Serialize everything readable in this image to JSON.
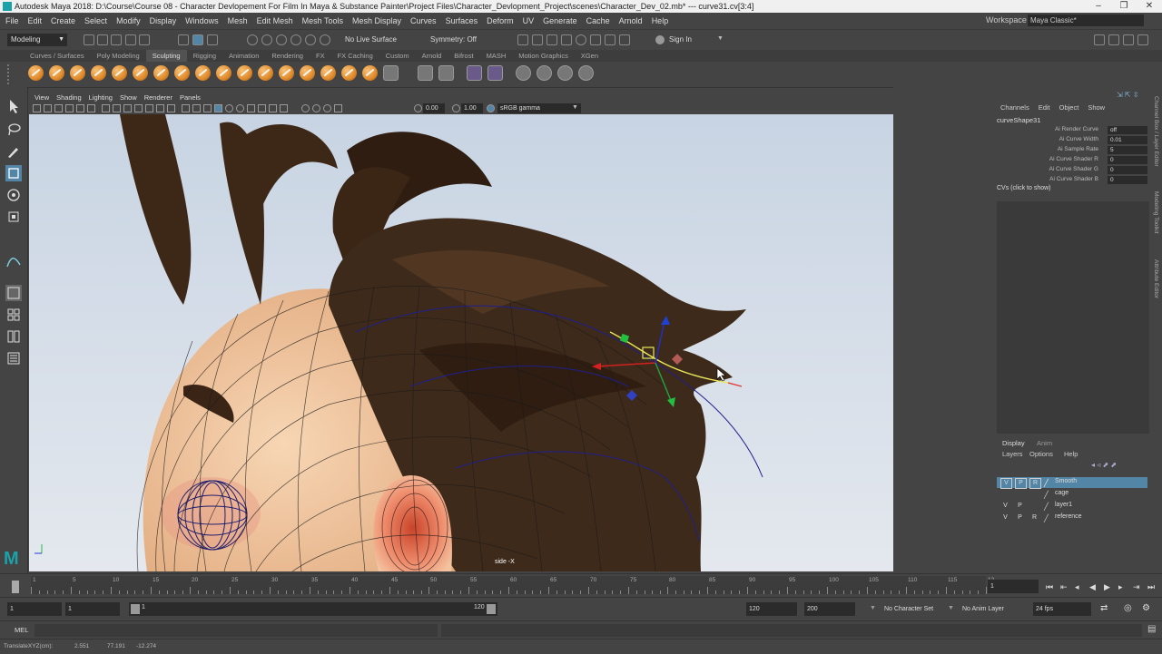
{
  "window": {
    "title": "Autodesk Maya 2018: D:\\Course\\Course 08 - Character Devlopement For Film In Maya & Substance Painter\\Project Files\\Character_Devlopment_Project\\scenes\\Character_Dev_02.mb*   ---   curve31.cv[3:4]",
    "min": "–",
    "max": "❐",
    "close": "✕"
  },
  "menu": {
    "items": [
      "File",
      "Edit",
      "Create",
      "Select",
      "Modify",
      "Display",
      "Windows",
      "Mesh",
      "Edit Mesh",
      "Mesh Tools",
      "Mesh Display",
      "Curves",
      "Surfaces",
      "Deform",
      "UV",
      "Generate",
      "Cache",
      "Arnold",
      "Help"
    ],
    "workspace_label": "Workspace :",
    "workspace_value": "Maya Classic*"
  },
  "statusline": {
    "mode": "Modeling",
    "live_surface": "No Live Surface",
    "symmetry": "Symmetry: Off",
    "sign_in": "Sign In"
  },
  "shelf": {
    "tabs": [
      "Curves / Surfaces",
      "Poly Modeling",
      "Sculpting",
      "Rigging",
      "Animation",
      "Rendering",
      "FX",
      "FX Caching",
      "Custom",
      "Arnold",
      "Bifrost",
      "MASH",
      "Motion Graphics",
      "XGen"
    ],
    "active_tab": "Sculpting"
  },
  "viewport": {
    "menu": [
      "View",
      "Shading",
      "Lighting",
      "Show",
      "Renderer",
      "Panels"
    ],
    "exposure": "0.00",
    "gamma": "1.00",
    "color_space": "sRGB gamma",
    "camera_label": "side -X"
  },
  "channel_box": {
    "menu": [
      "Channels",
      "Edit",
      "Object",
      "Show"
    ],
    "object": "curveShape31",
    "attributes": [
      {
        "name": "Ai Render Curve",
        "value": "off"
      },
      {
        "name": "Ai Curve Width",
        "value": "0.01"
      },
      {
        "name": "Ai Sample Rate",
        "value": "5"
      },
      {
        "name": "Ai Curve Shader R",
        "value": "0"
      },
      {
        "name": "Ai Curve Shader G",
        "value": "0"
      },
      {
        "name": "Ai Curve Shader B",
        "value": "0"
      }
    ],
    "cvs_label": "CVs (click to show)"
  },
  "side_tabs": [
    "Channel Box / Layer Editor",
    "Modeling Toolkit",
    "Attribute Editor"
  ],
  "layers": {
    "tabs": [
      "Display",
      "Anim"
    ],
    "menu": [
      "Layers",
      "Options",
      "Help"
    ],
    "rows": [
      {
        "v": "V",
        "p": "P",
        "r": "R",
        "name": "Smooth",
        "selected": true
      },
      {
        "v": "",
        "p": "",
        "r": "",
        "name": "cage",
        "selected": false
      },
      {
        "v": "V",
        "p": "P",
        "r": "",
        "name": "layer1",
        "selected": false
      },
      {
        "v": "V",
        "p": "P",
        "r": "R",
        "name": "reference",
        "selected": false
      }
    ]
  },
  "timeline": {
    "ticks": [
      "1",
      "5",
      "10",
      "15",
      "20",
      "25",
      "30",
      "35",
      "40",
      "45",
      "50",
      "55",
      "60",
      "65",
      "70",
      "75",
      "80",
      "85",
      "90",
      "95",
      "100",
      "105",
      "110",
      "115",
      "12"
    ],
    "current_frame": "1"
  },
  "range": {
    "start": "1",
    "playback_start": "1",
    "slider_start": "1",
    "slider_end": "120",
    "playback_end": "120",
    "end": "200",
    "character_set": "No Character Set",
    "anim_layer": "No Anim Layer",
    "fps": "24 fps"
  },
  "mel": {
    "label": "MEL"
  },
  "help_line": {
    "label": "TranslateXYZ(cm):",
    "x": "2.551",
    "y": "77.191",
    "z": "-12.274"
  },
  "colors": {
    "selected_layer": "#5285a6",
    "active_tool": "#5285a6",
    "sculpt_orange": "#e08a2a"
  }
}
